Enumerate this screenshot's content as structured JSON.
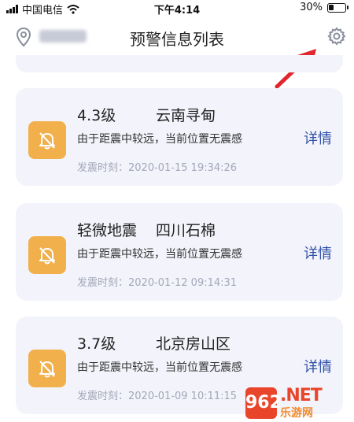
{
  "status_bar": {
    "carrier": "中国电信",
    "time": "下午4:14",
    "battery": "30%",
    "battery_level": 0.3
  },
  "header": {
    "title": "预警信息列表",
    "location_icon": "location-pin-icon",
    "settings_icon": "gear-icon"
  },
  "alerts": [
    {
      "magnitude": "4.3级",
      "location": "云南寻甸",
      "description": "由于距震中较远，当前位置无震感",
      "time": "发震时刻：2020-01-15 19:34:26",
      "detail_label": "详情"
    },
    {
      "magnitude": "轻微地震",
      "location": "四川石棉",
      "description": "由于距震中较远，当前位置无震感",
      "time": "发震时刻：2020-01-12 09:14:31",
      "detail_label": "详情"
    },
    {
      "magnitude": "3.7级",
      "location": "北京房山区",
      "description": "由于距震中较远，当前位置无震感",
      "time": "发震时刻：2020-01-09 10:11:15",
      "detail_label": "详情"
    }
  ],
  "watermark": {
    "badge": "962",
    "top_text": ".NET",
    "bottom_text": "乐游网"
  },
  "colors": {
    "card_bg": "#f3f4fb",
    "bell_bg": "#f2b04c",
    "detail_link": "#2f4fa8",
    "arrow": "#e0262e"
  }
}
